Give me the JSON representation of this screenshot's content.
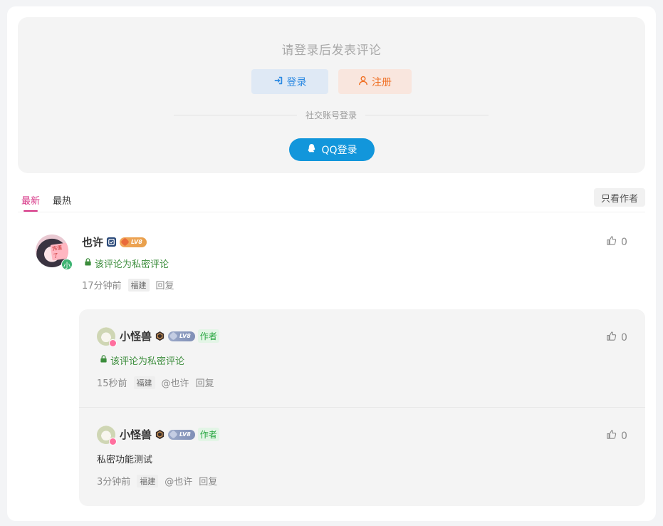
{
  "login": {
    "title": "请登录后发表评论",
    "login_label": "登录",
    "register_label": "注册",
    "social_label": "社交账号登录",
    "qq_label": "QQ登录"
  },
  "tabs": {
    "latest": "最新",
    "hot": "最热",
    "author_only": "只看作者"
  },
  "comments": [
    {
      "username": "也许",
      "avatar_badge": "小",
      "avatar_tag": "完蛋了",
      "level": "LV8",
      "text": "该评论为私密评论",
      "time": "17分钟前",
      "location": "福建",
      "reply": "回复",
      "likes": "0"
    }
  ],
  "replies": [
    {
      "username": "小怪兽",
      "level": "LV8",
      "author_tag": "作者",
      "text": "该评论为私密评论",
      "time": "15秒前",
      "location": "福建",
      "mention": "@也许",
      "reply": "回复",
      "likes": "0"
    },
    {
      "username": "小怪兽",
      "level": "LV8",
      "author_tag": "作者",
      "text": "私密功能测试",
      "time": "3分钟前",
      "location": "福建",
      "mention": "@也许",
      "reply": "回复",
      "likes": "0"
    }
  ],
  "colors": {
    "accent_pink": "#d63384",
    "qq_blue": "#1296db",
    "login_blue": "#2d8ae2",
    "register_orange": "#f07024",
    "private_green": "#3c8d3c"
  },
  "icons": {
    "login": "sign-in-icon",
    "register": "user-icon",
    "qq": "qq-penguin-icon",
    "lock": "lock-icon",
    "like": "thumbs-up-icon",
    "vip": "vip-shield-icon"
  }
}
